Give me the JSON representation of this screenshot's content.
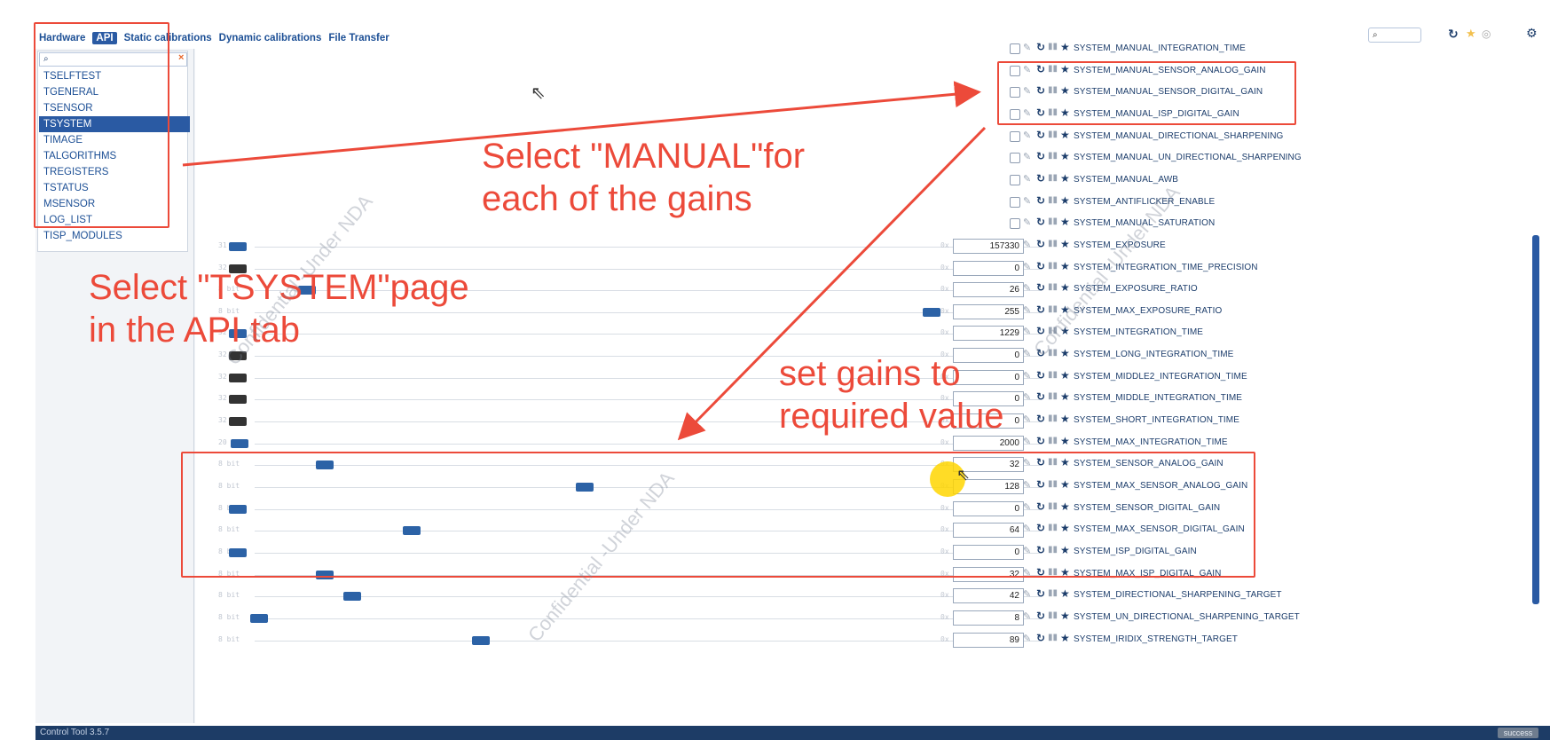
{
  "tabs": [
    {
      "label": "Hardware",
      "active": false
    },
    {
      "label": "API",
      "active": true
    },
    {
      "label": "Static calibrations",
      "active": false
    },
    {
      "label": "Dynamic calibrations",
      "active": false
    },
    {
      "label": "File Transfer",
      "active": false
    }
  ],
  "top_search": {
    "icon": "search-icon",
    "value": ""
  },
  "sidebar": {
    "search_value": "",
    "items": [
      {
        "label": "TSELFTEST",
        "selected": false
      },
      {
        "label": "TGENERAL",
        "selected": false
      },
      {
        "label": "TSENSOR",
        "selected": false
      },
      {
        "label": "TSYSTEM",
        "selected": true
      },
      {
        "label": "TIMAGE",
        "selected": false
      },
      {
        "label": "TALGORITHMS",
        "selected": false
      },
      {
        "label": "TREGISTERS",
        "selected": false
      },
      {
        "label": "TSTATUS",
        "selected": false
      },
      {
        "label": "MSENSOR",
        "selected": false
      },
      {
        "label": "LOG_LIST",
        "selected": false
      },
      {
        "label": "TISP_MODULES",
        "selected": false
      }
    ]
  },
  "checkbox_params": [
    "SYSTEM_MANUAL_INTEGRATION_TIME",
    "SYSTEM_MANUAL_SENSOR_ANALOG_GAIN",
    "SYSTEM_MANUAL_SENSOR_DIGITAL_GAIN",
    "SYSTEM_MANUAL_ISP_DIGITAL_GAIN",
    "SYSTEM_MANUAL_DIRECTIONAL_SHARPENING",
    "SYSTEM_MANUAL_UN_DIRECTIONAL_SHARPENING",
    "SYSTEM_MANUAL_AWB",
    "SYSTEM_ANTIFLICKER_ENABLE",
    "SYSTEM_MANUAL_SATURATION"
  ],
  "slider_params": [
    {
      "bits": "31 bit",
      "value": "157330",
      "name": "SYSTEM_EXPOSURE",
      "level": 0.0,
      "dark": false
    },
    {
      "bits": "32 bit",
      "value": "0",
      "name": "SYSTEM_INTEGRATION_TIME_PRECISION",
      "level": 0.0,
      "dark": true
    },
    {
      "bits": "8 bit",
      "value": "26",
      "name": "SYSTEM_EXPOSURE_RATIO",
      "level": 0.1,
      "dark": false
    },
    {
      "bits": "8 bit",
      "value": "255",
      "name": "SYSTEM_MAX_EXPOSURE_RATIO",
      "level": 1.0,
      "dark": false
    },
    {
      "bits": "32 bit",
      "value": "1229",
      "name": "SYSTEM_INTEGRATION_TIME",
      "level": 0.0,
      "dark": false
    },
    {
      "bits": "32 bit",
      "value": "0",
      "name": "SYSTEM_LONG_INTEGRATION_TIME",
      "level": 0.0,
      "dark": true
    },
    {
      "bits": "32 bit",
      "value": "0",
      "name": "SYSTEM_MIDDLE2_INTEGRATION_TIME",
      "level": 0.0,
      "dark": true
    },
    {
      "bits": "32 bit",
      "value": "0",
      "name": "SYSTEM_MIDDLE_INTEGRATION_TIME",
      "level": 0.0,
      "dark": true
    },
    {
      "bits": "32 bit",
      "value": "0",
      "name": "SYSTEM_SHORT_INTEGRATION_TIME",
      "level": 0.0,
      "dark": true
    },
    {
      "bits": "20 bit",
      "value": "2000",
      "name": "SYSTEM_MAX_INTEGRATION_TIME",
      "level": 0.002,
      "dark": false
    },
    {
      "bits": "8 bit",
      "value": "32",
      "name": "SYSTEM_SENSOR_ANALOG_GAIN",
      "level": 0.125,
      "dark": false
    },
    {
      "bits": "8 bit",
      "value": "128",
      "name": "SYSTEM_MAX_SENSOR_ANALOG_GAIN",
      "level": 0.5,
      "dark": false
    },
    {
      "bits": "8 bit",
      "value": "0",
      "name": "SYSTEM_SENSOR_DIGITAL_GAIN",
      "level": 0.0,
      "dark": false
    },
    {
      "bits": "8 bit",
      "value": "64",
      "name": "SYSTEM_MAX_SENSOR_DIGITAL_GAIN",
      "level": 0.25,
      "dark": false
    },
    {
      "bits": "8 bit",
      "value": "0",
      "name": "SYSTEM_ISP_DIGITAL_GAIN",
      "level": 0.0,
      "dark": false
    },
    {
      "bits": "8 bit",
      "value": "32",
      "name": "SYSTEM_MAX_ISP_DIGITAL_GAIN",
      "level": 0.125,
      "dark": false
    },
    {
      "bits": "8 bit",
      "value": "42",
      "name": "SYSTEM_DIRECTIONAL_SHARPENING_TARGET",
      "level": 0.165,
      "dark": false
    },
    {
      "bits": "8 bit",
      "value": "8",
      "name": "SYSTEM_UN_DIRECTIONAL_SHARPENING_TARGET",
      "level": 0.031,
      "dark": false
    },
    {
      "bits": "8 bit",
      "value": "89",
      "name": "SYSTEM_IRIDIX_STRENGTH_TARGET",
      "level": 0.35,
      "dark": false
    }
  ],
  "hex_prefix": "0x",
  "annotations": {
    "note_manual": [
      "Select \"MANUAL\"for",
      "each of the gains"
    ],
    "note_tsystem": [
      "Select \"TSYSTEM\"page",
      "in the API tab"
    ],
    "note_gains": [
      "set gains to",
      "required value"
    ],
    "watermark": "Confidential -Under NDA"
  },
  "status_bar": {
    "title": "Control Tool  3.5.7",
    "badge": "success"
  },
  "colors": {
    "accent": "#2a5aa3",
    "annotation_red": "#ec4a3a",
    "status_bar": "#1d3c66",
    "thumb": "#2c62a6"
  }
}
